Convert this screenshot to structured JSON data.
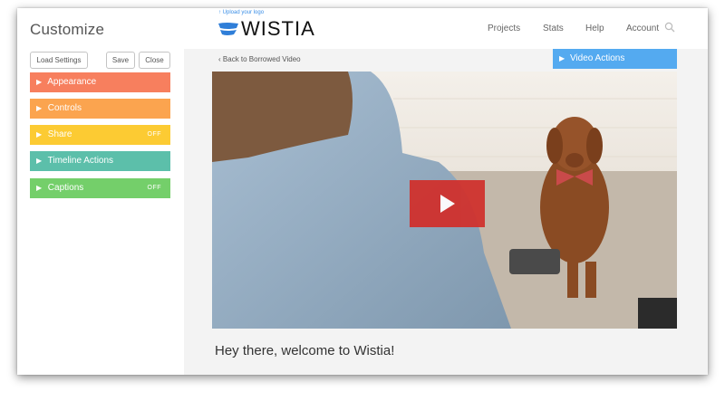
{
  "sidebar": {
    "title": "Customize",
    "buttons": {
      "load": "Load Settings",
      "save": "Save",
      "close": "Close"
    },
    "sections": [
      {
        "label": "Appearance",
        "status": "",
        "color": "#f77f5e"
      },
      {
        "label": "Controls",
        "status": "",
        "color": "#fba44f"
      },
      {
        "label": "Share",
        "status": "OFF",
        "color": "#fccb33"
      },
      {
        "label": "Timeline Actions",
        "status": "",
        "color": "#5cbfaa"
      },
      {
        "label": "Captions",
        "status": "OFF",
        "color": "#74cf6a"
      }
    ]
  },
  "header": {
    "upload_logo": "Upload your logo",
    "logo_text": "WISTIA",
    "logo_color": "#2f7ed8",
    "nav": [
      "Projects",
      "Stats",
      "Help",
      "Account"
    ]
  },
  "main": {
    "back_link": "Back to Borrowed Video",
    "video_actions": "Video Actions",
    "video_title": "Hey there, welcome to Wistia!",
    "play_button_color": "#d0312d"
  }
}
